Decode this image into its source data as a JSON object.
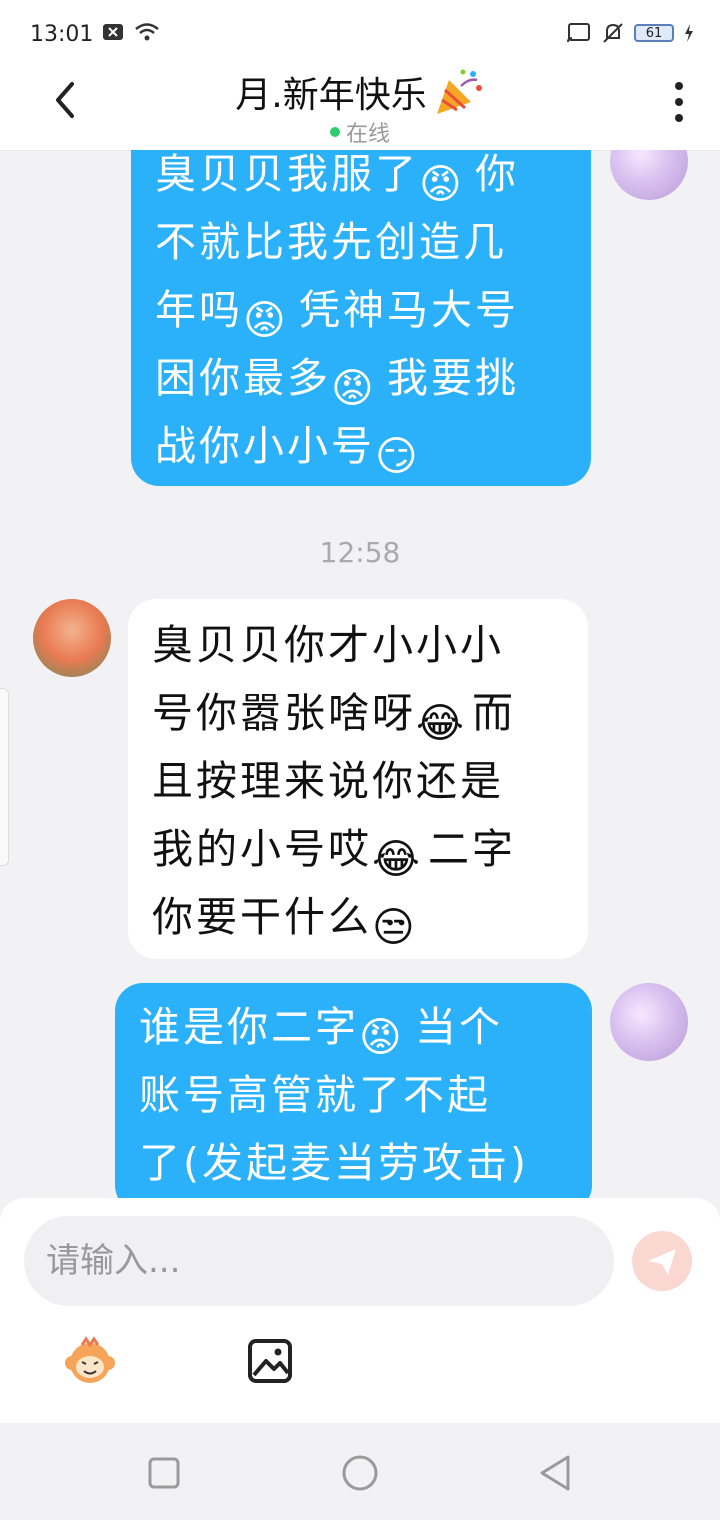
{
  "status_bar": {
    "time": "13:01",
    "battery": "61"
  },
  "header": {
    "title": "月.新年快乐",
    "status": "在线"
  },
  "messages": [
    {
      "side": "mine",
      "lines": [
        "臭贝贝我服了[angry]你",
        "不就比我先创造几",
        "年吗[angry]凭神马大号",
        "困你最多[angry]我要挑",
        "战你小小号[smirk]"
      ]
    },
    {
      "type": "time",
      "text": "12:58"
    },
    {
      "side": "theirs",
      "lines": [
        "臭贝贝你才小小小",
        "号你嚣张啥呀[laugh]而",
        "且按理来说你还是",
        "我的小号哎[laugh]二字",
        "你要干什么[unamused]"
      ]
    },
    {
      "side": "mine",
      "lines": [
        "谁是你二字[angry]当个",
        "账号高管就了不起",
        "了(发起麦当劳攻击)"
      ]
    }
  ],
  "input": {
    "placeholder": "请输入..."
  },
  "icons": {
    "back": "back-arrow-icon",
    "more": "more-vertical-icon",
    "send": "send-icon",
    "emoji_tool": "monkey-emoji-icon",
    "image_tool": "image-icon",
    "nav_square": "recent-apps-icon",
    "nav_circle": "home-icon",
    "nav_back": "back-triangle-icon"
  },
  "colors": {
    "my_bubble": "#2ab1f9",
    "their_bubble": "#ffffff",
    "background": "#f2f2f4"
  }
}
